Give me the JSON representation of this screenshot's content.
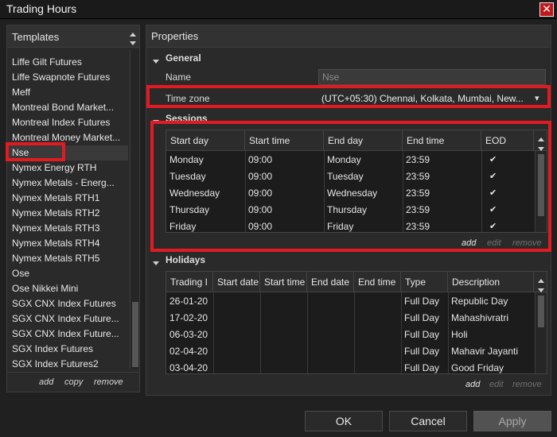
{
  "window": {
    "title": "Trading Hours",
    "close_glyph": "✕"
  },
  "templates": {
    "title": "Templates",
    "items": [
      "Liffe Gilt Futures",
      "Liffe Swapnote Futures",
      "Meff",
      "Montreal Bond Market...",
      "Montreal Index Futures",
      "Montreal Money Market...",
      "Nse",
      "Nymex Energy RTH",
      "Nymex Metals - Energ...",
      "Nymex Metals RTH1",
      "Nymex Metals RTH2",
      "Nymex Metals RTH3",
      "Nymex Metals RTH4",
      "Nymex Metals RTH5",
      "Ose",
      "Ose Nikkei Mini",
      "SGX CNX Index Futures",
      "SGX CNX Index Future...",
      "SGX CNX Index Future...",
      "SGX Index Futures",
      "SGX Index Futures2"
    ],
    "selected": "Nse",
    "actions": {
      "add": "add",
      "copy": "copy",
      "remove": "remove"
    }
  },
  "properties": {
    "title": "Properties",
    "general": {
      "title": "General",
      "name_label": "Name",
      "name_value": "Nse",
      "timezone_label": "Time zone",
      "timezone_value": "(UTC+05:30) Chennai, Kolkata, Mumbai, New..."
    },
    "sessions": {
      "title": "Sessions",
      "columns": [
        "Start day",
        "Start time",
        "End day",
        "End time",
        "EOD"
      ],
      "rows": [
        [
          "Monday",
          "09:00",
          "Monday",
          "23:59",
          "✔"
        ],
        [
          "Tuesday",
          "09:00",
          "Tuesday",
          "23:59",
          "✔"
        ],
        [
          "Wednesday",
          "09:00",
          "Wednesday",
          "23:59",
          "✔"
        ],
        [
          "Thursday",
          "09:00",
          "Thursday",
          "23:59",
          "✔"
        ],
        [
          "Friday",
          "09:00",
          "Friday",
          "23:59",
          "✔"
        ]
      ],
      "actions": {
        "add": "add",
        "edit": "edit",
        "remove": "remove"
      }
    },
    "holidays": {
      "title": "Holidays",
      "columns": [
        "Trading I",
        "Start date",
        "Start time",
        "End date",
        "End time",
        "Type",
        "Description"
      ],
      "rows": [
        [
          "26-01-20",
          "",
          "",
          "",
          "",
          "Full Day",
          "Republic Day"
        ],
        [
          "17-02-20",
          "",
          "",
          "",
          "",
          "Full Day",
          "Mahashivratri"
        ],
        [
          "06-03-20",
          "",
          "",
          "",
          "",
          "Full Day",
          "Holi"
        ],
        [
          "02-04-20",
          "",
          "",
          "",
          "",
          "Full Day",
          "Mahavir Jayanti"
        ],
        [
          "03-04-20",
          "",
          "",
          "",
          "",
          "Full Day",
          "Good Friday"
        ]
      ],
      "actions": {
        "add": "add",
        "edit": "edit",
        "remove": "remove"
      }
    }
  },
  "buttons": {
    "ok": "OK",
    "cancel": "Cancel",
    "apply": "Apply"
  },
  "colors": {
    "highlight": "#e21a22",
    "background": "#202020"
  }
}
